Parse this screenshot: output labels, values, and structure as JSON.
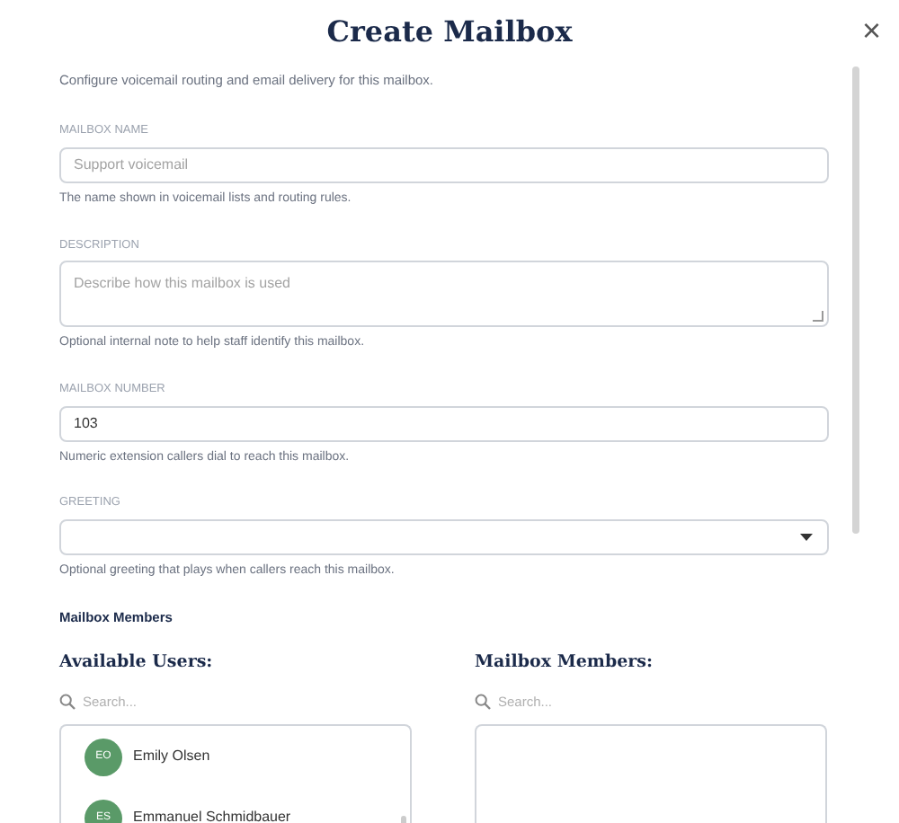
{
  "dialog": {
    "title": "Create Mailbox",
    "close": "×",
    "intro": "Configure voicemail routing and email delivery for this mailbox."
  },
  "fields": [
    {
      "kind": "text",
      "label": "MAILBOX NAME",
      "placeholder": "Support voicemail",
      "help": "The name shown in voicemail lists and routing rules."
    },
    {
      "kind": "textarea",
      "label": "DESCRIPTION",
      "placeholder": "Describe how this mailbox is used",
      "help": "Optional internal note to help staff identify this mailbox."
    },
    {
      "kind": "text",
      "label": "MAILBOX NUMBER",
      "value": "103",
      "help": "Numeric extension callers dial to reach this mailbox."
    },
    {
      "kind": "select",
      "label": "GREETING",
      "help": "Optional greeting that plays when callers reach this mailbox."
    }
  ],
  "members": {
    "title": "Mailbox Members",
    "lists": [
      {
        "heading": "Available Users:",
        "search_placeholder": "Search...",
        "users": [
          {
            "initials": "EO",
            "name": "Emily Olsen"
          },
          {
            "initials": "ES",
            "name": "Emmanuel Schmidbauer"
          }
        ]
      },
      {
        "heading": "Mailbox Members:",
        "search_placeholder": "Search..."
      }
    ]
  }
}
